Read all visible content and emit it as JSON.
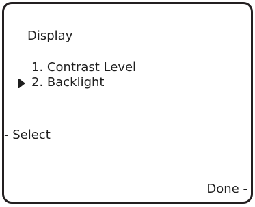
{
  "screen": {
    "title": "Display",
    "menu_items": [
      {
        "label": "1. Contrast Level",
        "selected": false
      },
      {
        "label": "2. Backlight",
        "selected": true
      }
    ],
    "cursor_icon": "triangle-right",
    "softkeys": {
      "select_label": "- Select",
      "done_label": "Done -"
    }
  }
}
